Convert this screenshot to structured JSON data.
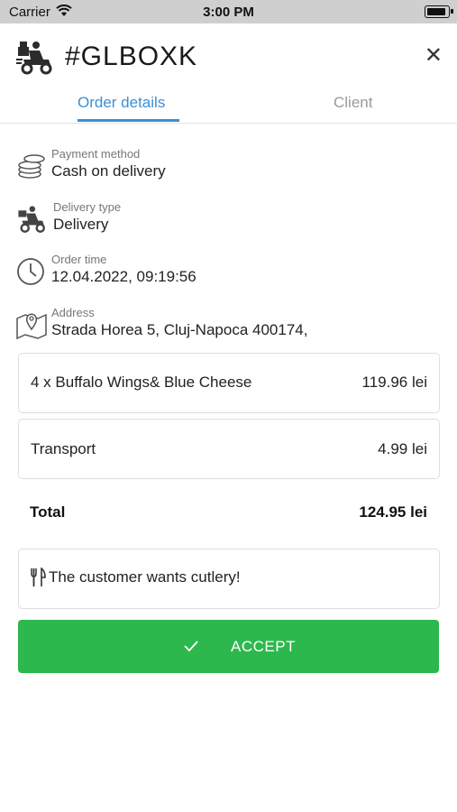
{
  "status_bar": {
    "carrier": "Carrier",
    "time": "3:00 PM"
  },
  "header": {
    "order_id": "#GLBOXK"
  },
  "tabs": [
    {
      "label": "Order details",
      "active": true
    },
    {
      "label": "Client",
      "active": false
    }
  ],
  "info": {
    "payment": {
      "label": "Payment method",
      "value": "Cash on delivery",
      "icon": "coins-icon"
    },
    "delivery": {
      "label": "Delivery type",
      "value": "Delivery",
      "icon": "scooter-icon"
    },
    "time": {
      "label": "Order time",
      "value": "12.04.2022, 09:19:56",
      "icon": "clock-icon"
    },
    "address": {
      "label": "Address",
      "value": "Strada Horea 5, Cluj-Napoca 400174,",
      "icon": "map-icon"
    }
  },
  "items": [
    {
      "name": "4 x Buffalo Wings& Blue Cheese",
      "price": "119.96 lei"
    }
  ],
  "transport": {
    "label": "Transport",
    "price": "4.99 lei"
  },
  "total": {
    "label": "Total",
    "price": "124.95 lei"
  },
  "note": {
    "text": "The customer wants cutlery!",
    "icon": "cutlery-icon"
  },
  "accept": {
    "label": "ACCEPT",
    "color": "#2db84d"
  },
  "colors": {
    "accent": "#3a8fd8",
    "accept_green": "#2db84d"
  }
}
